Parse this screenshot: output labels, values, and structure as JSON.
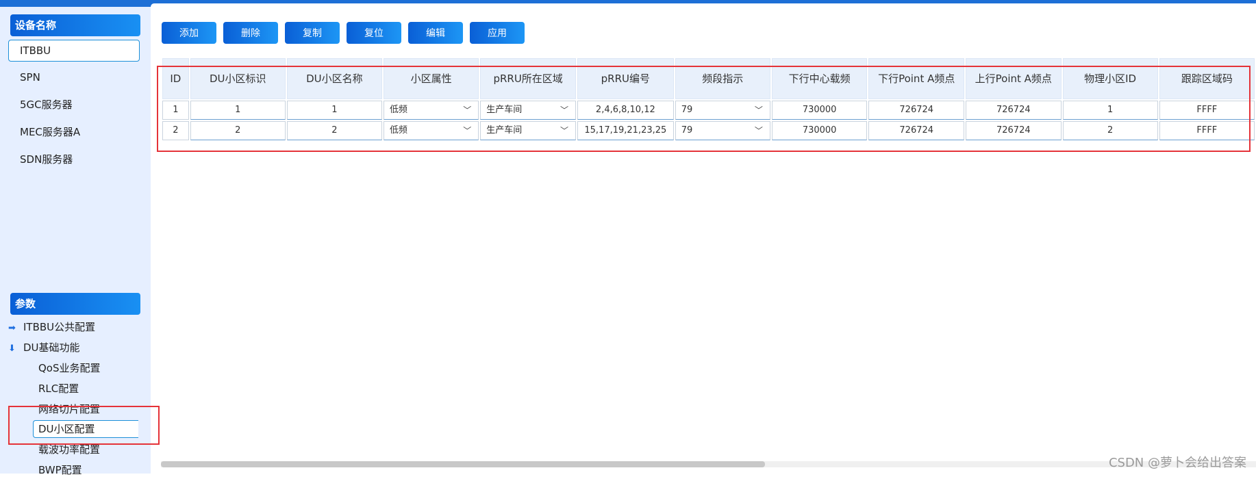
{
  "sidebar": {
    "device_header": "设备名称",
    "devices": [
      "ITBBU",
      "SPN",
      "5GC服务器",
      "MEC服务器A",
      "SDN服务器"
    ],
    "selected_device": "ITBBU",
    "params_header": "参数",
    "tree": [
      {
        "label": "ITBBU公共配置",
        "expanded": false,
        "icon": "arrow-right-icon"
      },
      {
        "label": "DU基础功能",
        "expanded": true,
        "icon": "arrow-down-icon"
      }
    ],
    "children": [
      "QoS业务配置",
      "RLC配置",
      "网络切片配置",
      "DU小区配置",
      "载波功率配置",
      "BWP配置"
    ],
    "selected_child": "DU小区配置"
  },
  "toolbar": {
    "add": "添加",
    "delete": "删除",
    "copy": "复制",
    "reset": "复位",
    "edit": "编辑",
    "apply": "应用"
  },
  "table": {
    "headers": [
      "ID",
      "DU小区标识",
      "DU小区名称",
      "小区属性",
      "pRRU所在区域",
      "pRRU编号",
      "频段指示",
      "下行中心载频",
      "下行Point A频点",
      "上行Point A频点",
      "物理小区ID",
      "跟踪区域码"
    ],
    "rows": [
      {
        "id": "1",
        "du_cell_id": "1",
        "du_cell_name": "1",
        "cell_attr": "低频",
        "prru_area": "生产车间",
        "prru_no": "2,4,6,8,10,12",
        "band": "79",
        "dl_freq": "730000",
        "dl_point_a": "726724",
        "ul_point_a": "726724",
        "pci": "1",
        "tac": "FFFF"
      },
      {
        "id": "2",
        "du_cell_id": "2",
        "du_cell_name": "2",
        "cell_attr": "低频",
        "prru_area": "生产车间",
        "prru_no": "15,17,19,21,23,25",
        "band": "79",
        "dl_freq": "730000",
        "dl_point_a": "726724",
        "ul_point_a": "726724",
        "pci": "2",
        "tac": "FFFF"
      }
    ]
  },
  "watermark": "CSDN @萝卜会给出答案",
  "colors": {
    "accent": "#1d6fd6",
    "highlight": "#e53238",
    "sidebar_bg": "#e6efff"
  }
}
